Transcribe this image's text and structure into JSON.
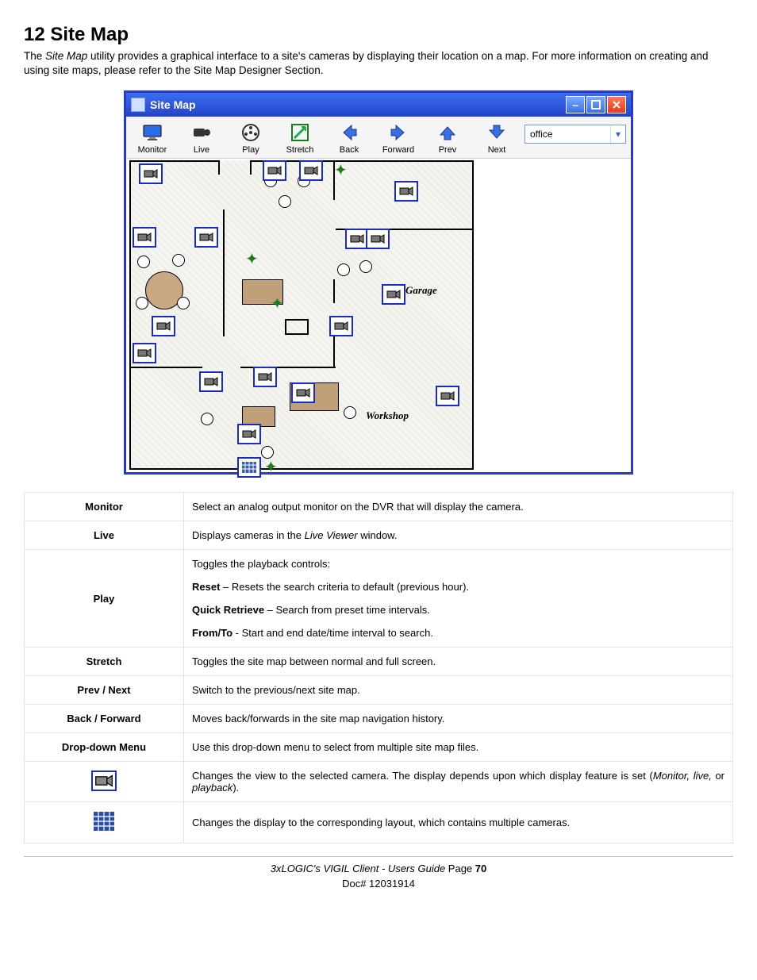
{
  "heading": "12  Site Map",
  "intro_plain": "The Site Map utility provides a graphical interface to a site's cameras by displaying their location on a map. For more information on creating and using site maps, please refer to the Site Map Designer Section.",
  "intro_em": "Site Map",
  "window": {
    "title": "Site Map",
    "dropdown_value": "office",
    "toolbar": [
      {
        "label": "Monitor",
        "icon": "monitor-icon"
      },
      {
        "label": "Live",
        "icon": "camera-icon"
      },
      {
        "label": "Play",
        "icon": "reel-icon"
      },
      {
        "label": "Stretch",
        "icon": "stretch-icon"
      },
      {
        "label": "Back",
        "icon": "arrow-left-icon"
      },
      {
        "label": "Forward",
        "icon": "arrow-right-icon"
      },
      {
        "label": "Prev",
        "icon": "arrow-up-icon"
      },
      {
        "label": "Next",
        "icon": "arrow-down-icon"
      }
    ],
    "map_labels": {
      "garage": "Garage",
      "workshop": "Workshop"
    }
  },
  "table": {
    "rows": [
      {
        "label": "Monitor",
        "text": "Select an analog output monitor on the DVR that will display the camera."
      },
      {
        "label": "Live",
        "text": "Displays cameras in the Live Viewer window.",
        "em": "Live Viewer"
      },
      {
        "label": "Play",
        "lines": [
          "Toggles the playback controls:",
          {
            "bold": "Reset",
            "rest": " – Resets the search criteria to default (previous hour)."
          },
          {
            "bold": "Quick Retrieve",
            "rest": " – Search from preset time intervals."
          },
          {
            "bold": "From/To",
            "rest": " - Start and end date/time interval to search."
          }
        ]
      },
      {
        "label": "Stretch",
        "text": "Toggles the site map between normal and full screen."
      },
      {
        "label": "Prev / Next",
        "text": "Switch to the previous/next site map."
      },
      {
        "label": "Back / Forward",
        "text": "Moves back/forwards in the site map navigation history."
      },
      {
        "label": "Drop-down Menu",
        "text": "Use this drop-down menu to select from multiple site map files."
      },
      {
        "icon": "camera-marker-icon",
        "text": "Changes the view to the selected camera. The display depends upon which display feature is set (Monitor, live, or playback).",
        "em": "Monitor, live,",
        "em2": "playback"
      },
      {
        "icon": "grid-layout-icon",
        "text": "Changes the display to the corresponding layout, which contains multiple cameras."
      }
    ]
  },
  "footer": {
    "line1_em": "3xLOGIC's VIGIL Client - Users Guide",
    "line1_plain": " Page ",
    "page": "70",
    "line2": "Doc# 12031914"
  }
}
